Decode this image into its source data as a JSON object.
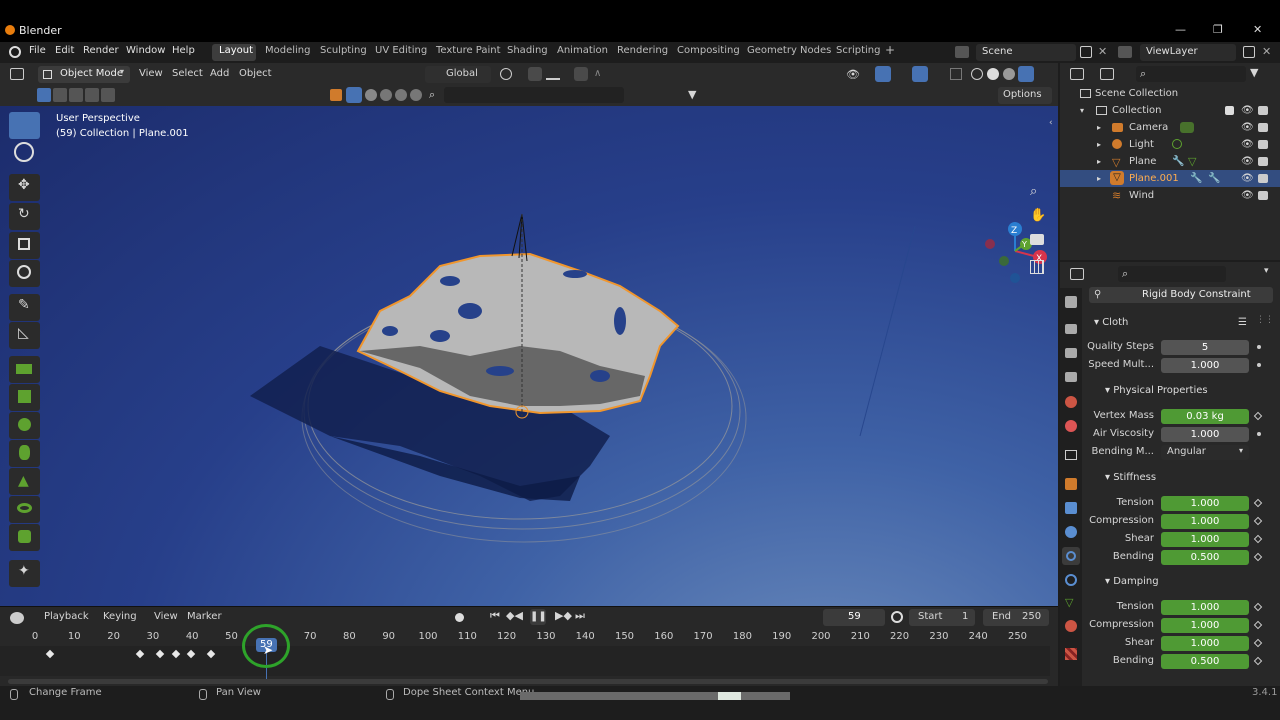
{
  "window": {
    "title": "Blender",
    "controls": [
      "—",
      "❐",
      "✕"
    ]
  },
  "menubar": {
    "items": [
      "File",
      "Edit",
      "Render",
      "Window",
      "Help"
    ],
    "workspaces": [
      "Layout",
      "Modeling",
      "Sculpting",
      "UV Editing",
      "Texture Paint",
      "Shading",
      "Animation",
      "Rendering",
      "Compositing",
      "Geometry Nodes",
      "Scripting"
    ],
    "active_workspace": "Layout",
    "add_tab": "+",
    "scene": "Scene",
    "view_layer": "ViewLayer"
  },
  "viewport_header": {
    "mode": "Object Mode",
    "menus": [
      "View",
      "Select",
      "Add",
      "Object"
    ],
    "orientation": "Global",
    "options": "Options"
  },
  "viewport": {
    "perspective_label": "User Perspective",
    "collection_label": "(59) Collection | Plane.001",
    "gizmo_axes": {
      "x": "X",
      "y": "Y",
      "z": "Z"
    }
  },
  "timeline": {
    "menus": [
      "Playback",
      "Keying",
      "View",
      "Marker"
    ],
    "current_frame": "59",
    "start_label": "Start",
    "start": "1",
    "end_label": "End",
    "end": "250",
    "ticks": [
      "0",
      "10",
      "20",
      "30",
      "40",
      "50",
      "59",
      "70",
      "80",
      "90",
      "100",
      "110",
      "120",
      "130",
      "140",
      "150",
      "160",
      "170",
      "180",
      "190",
      "200",
      "210",
      "220",
      "230",
      "240",
      "250"
    ],
    "keyframes": [
      2,
      25,
      30,
      34,
      38,
      43
    ]
  },
  "statusbar": {
    "items": [
      "Change Frame",
      "Pan View",
      "Dope Sheet Context Menu"
    ],
    "version": "3.4.1"
  },
  "outliner": {
    "root": "Scene Collection",
    "collection": "Collection",
    "items": [
      {
        "name": "Camera",
        "selected": false
      },
      {
        "name": "Light",
        "selected": false
      },
      {
        "name": "Plane",
        "selected": false
      },
      {
        "name": "Plane.001",
        "selected": true
      },
      {
        "name": "Wind",
        "selected": false
      }
    ]
  },
  "properties": {
    "rigid_body_button": "Rigid Body Constraint",
    "cloth_panel": "Cloth",
    "quality_steps_label": "Quality Steps",
    "quality_steps": "5",
    "speed_mult_label": "Speed Mult...",
    "speed_mult": "1.000",
    "physical_header": "Physical Properties",
    "vertex_mass_label": "Vertex Mass",
    "vertex_mass": "0.03 kg",
    "air_viscosity_label": "Air Viscosity",
    "air_viscosity": "1.000",
    "bending_model_label": "Bending M...",
    "bending_model": "Angular",
    "stiffness_header": "Stiffness",
    "stiffness": [
      {
        "label": "Tension",
        "value": "1.000"
      },
      {
        "label": "Compression",
        "value": "1.000"
      },
      {
        "label": "Shear",
        "value": "1.000"
      },
      {
        "label": "Bending",
        "value": "0.500"
      }
    ],
    "damping_header": "Damping",
    "damping": [
      {
        "label": "Tension",
        "value": "1.000"
      },
      {
        "label": "Compression",
        "value": "1.000"
      },
      {
        "label": "Shear",
        "value": "1.000"
      },
      {
        "label": "Bending",
        "value": "0.500"
      }
    ]
  },
  "colors": {
    "accent": "#4772b3",
    "field_green": "#4f9a34",
    "selection": "#f0962d",
    "highlight_circle": "#2ea32a"
  }
}
